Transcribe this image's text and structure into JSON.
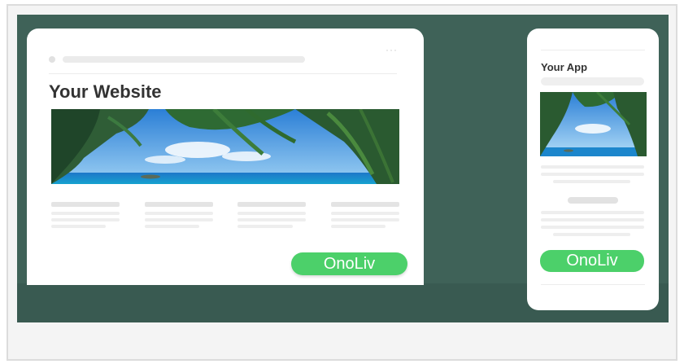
{
  "desktop_preview": {
    "title": "Your Website",
    "menu_glyph": "···",
    "cta_label": "OnoLiv"
  },
  "mobile_preview": {
    "title": "Your App",
    "cta_label": "OnoLiv"
  },
  "colors": {
    "stage_background": "#3f6258",
    "cta_green": "#4cd06a",
    "card_background": "#ffffff",
    "frame_background": "#f4f4f4"
  },
  "icons": {
    "hero_image": "tropical-beach-palm-image",
    "menu": "more-dots-icon"
  }
}
